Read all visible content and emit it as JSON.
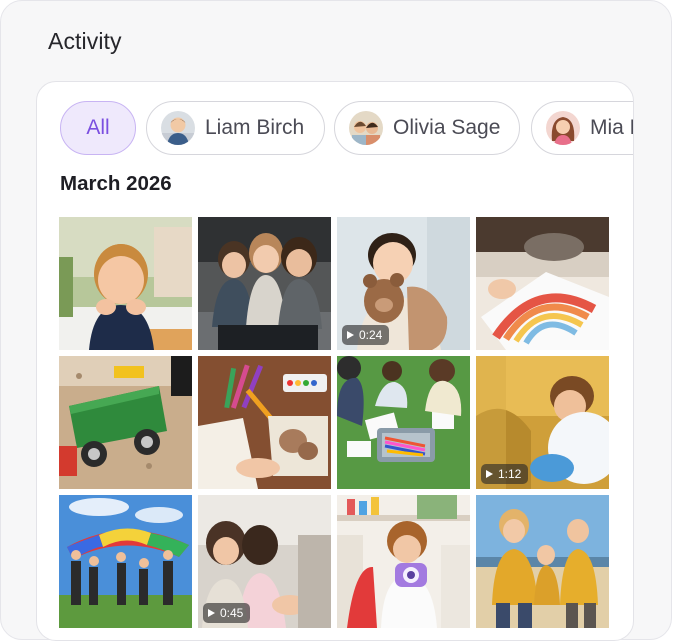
{
  "section_title": "Activity",
  "filters": [
    {
      "label": "All",
      "active": true
    },
    {
      "label": "Liam Birch",
      "active": false
    },
    {
      "label": "Olivia Sage",
      "active": false
    },
    {
      "label": "Mia L",
      "active": false
    }
  ],
  "month_heading": "March 2026",
  "media": [
    {
      "desc": "toddler-smiling-photo",
      "video": false,
      "duration": ""
    },
    {
      "desc": "three-kids-laughing-photo",
      "video": false,
      "duration": ""
    },
    {
      "desc": "toddler-with-teddy-bear-video",
      "video": true,
      "duration": "0:24"
    },
    {
      "desc": "rainbow-collage-craft-photo",
      "video": false,
      "duration": ""
    },
    {
      "desc": "toy-dump-truck-sand-photo",
      "video": false,
      "duration": ""
    },
    {
      "desc": "markers-and-clay-table-photo",
      "video": false,
      "duration": ""
    },
    {
      "desc": "kids-drawing-on-grass-photo",
      "video": false,
      "duration": ""
    },
    {
      "desc": "boy-with-balloon-video",
      "video": true,
      "duration": "1:12"
    },
    {
      "desc": "parachute-game-photo",
      "video": false,
      "duration": ""
    },
    {
      "desc": "girls-sitting-outdoors-video",
      "video": true,
      "duration": "0:45"
    },
    {
      "desc": "girl-with-toy-camera-photo",
      "video": false,
      "duration": ""
    },
    {
      "desc": "kids-dancing-beach-photo",
      "video": false,
      "duration": ""
    }
  ]
}
